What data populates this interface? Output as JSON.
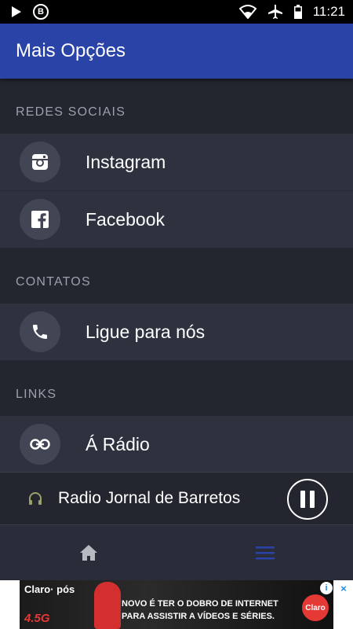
{
  "status_bar": {
    "time": "11:21",
    "notification_badge": "B"
  },
  "app_bar": {
    "title": "Mais Opções"
  },
  "sections": [
    {
      "header": "REDES SOCIAIS",
      "items": [
        {
          "label": "Instagram",
          "icon": "instagram-icon"
        },
        {
          "label": "Facebook",
          "icon": "facebook-icon"
        }
      ]
    },
    {
      "header": "CONTATOS",
      "items": [
        {
          "label": "Ligue para nós",
          "icon": "phone-icon"
        }
      ]
    },
    {
      "header": "LINKS",
      "items": [
        {
          "label": "Á Rádio",
          "icon": "link-icon"
        }
      ]
    }
  ],
  "player": {
    "station_name": "Radio Jornal de Barretos",
    "state_icon": "pause-icon"
  },
  "bottom_nav": {
    "items": [
      {
        "icon": "home-icon",
        "active": false
      },
      {
        "icon": "menu-icon",
        "active": true
      }
    ],
    "active_color": "#2a43a6",
    "inactive_color": "#b8bac2"
  },
  "ad": {
    "brand": "Claro· pós",
    "tag": "4.5G",
    "line1": "NOVO É TER O DOBRO DE INTERNET",
    "line2": "PARA ASSISTIR A VÍDEOS E SÉRIES.",
    "logo": "Claro"
  },
  "colors": {
    "app_bar": "#2a43a6",
    "background": "#23252f",
    "row": "#2e323f",
    "section_header_text": "#9c9fae"
  }
}
